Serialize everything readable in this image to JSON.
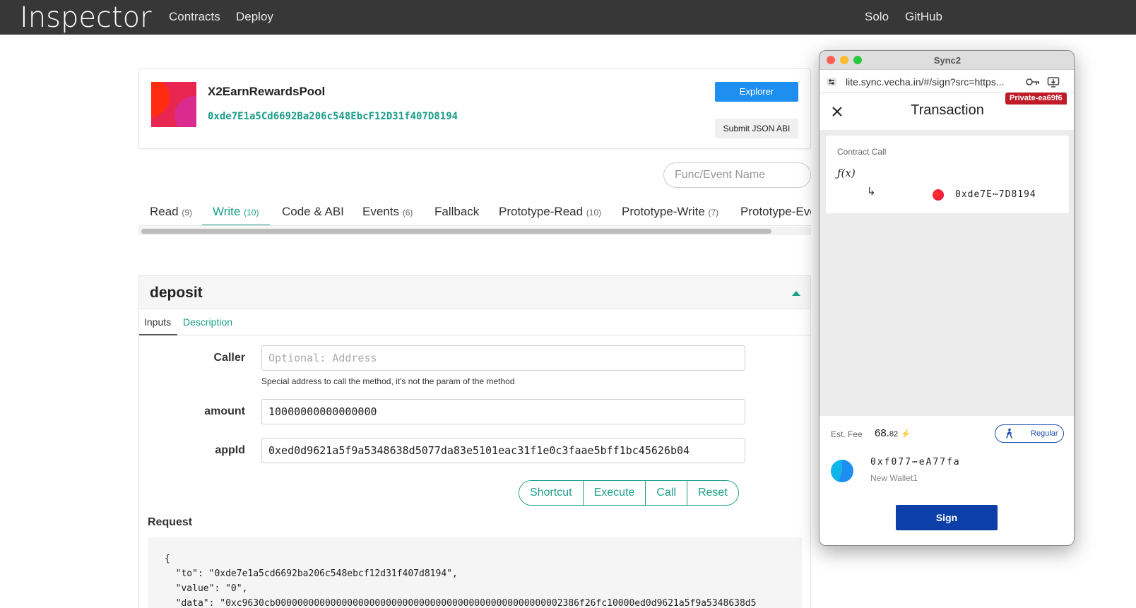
{
  "navbar": {
    "brand": "Inspector",
    "links": [
      "Contracts",
      "Deploy"
    ],
    "right_links": [
      "Solo",
      "GitHub"
    ]
  },
  "contract": {
    "name": "X2EarnRewardsPool",
    "address": "0xde7E1a5Cd6692Ba206c548EbcF12D31f407D8194",
    "explorer_label": "Explorer",
    "submit_abi_label": "Submit JSON ABI"
  },
  "search": {
    "placeholder": "Func/Event Name"
  },
  "tabs": [
    {
      "label": "Read",
      "count": "(9)"
    },
    {
      "label": "Write",
      "count": "(10)"
    },
    {
      "label": "Code & ABI",
      "count": ""
    },
    {
      "label": "Events",
      "count": "(6)"
    },
    {
      "label": "Fallback",
      "count": ""
    },
    {
      "label": "Prototype-Read",
      "count": "(10)"
    },
    {
      "label": "Prototype-Write",
      "count": "(7)"
    },
    {
      "label": "Prototype-Eve",
      "count": ""
    }
  ],
  "method": {
    "name": "deposit",
    "subtabs": {
      "inputs": "Inputs",
      "description": "Description"
    },
    "fields": {
      "caller": {
        "label": "Caller",
        "placeholder": "Optional: Address",
        "hint": "Special address to call the method, it's not the param of the method"
      },
      "amount": {
        "label": "amount",
        "value": "10000000000000000"
      },
      "appId": {
        "label": "appId",
        "value": "0xed0d9621a5f9a5348638d5077da83e5101eac31f1e0c3faae5bff1bc45626b04"
      }
    },
    "buttons": {
      "shortcut": "Shortcut",
      "execute": "Execute",
      "call": "Call",
      "reset": "Reset"
    },
    "request_label": "Request",
    "request_lines": [
      "{",
      "  \"to\": \"0xde7e1a5cd6692ba206c548ebcf12d31f407d8194\",",
      "  \"value\": \"0\",",
      "  \"data\": \"0xc9630cb0000000000000000000000000000000000000000000000000002386f26fc10000ed0d9621a5f9a5348638d5"
    ]
  },
  "sync2": {
    "window_title": "Sync2",
    "url": "lite.sync.vecha.in/#/sign?src=https...",
    "private_badge": "Private-ea69f6",
    "header_title": "Transaction",
    "clause": {
      "type_label": "Contract Call",
      "fx_label": "ƒ(x)",
      "arrow": "↳",
      "to_address": "0xde7E⋯7D8194"
    },
    "fee": {
      "label": "Est. Fee",
      "value_main": "68.",
      "value_decimals": "82",
      "bolt": "⚡",
      "priority_label": "Regular"
    },
    "wallet": {
      "address": "0xf077⋯eA77fa",
      "name": "New Wallet1"
    },
    "sign_label": "Sign"
  },
  "colors": {
    "navbar_bg": "#373737",
    "accent_teal": "#1a9e8a",
    "explorer_blue": "#1e8ff0",
    "sign_blue": "#0c3fa8",
    "private_red": "#c01c28"
  }
}
